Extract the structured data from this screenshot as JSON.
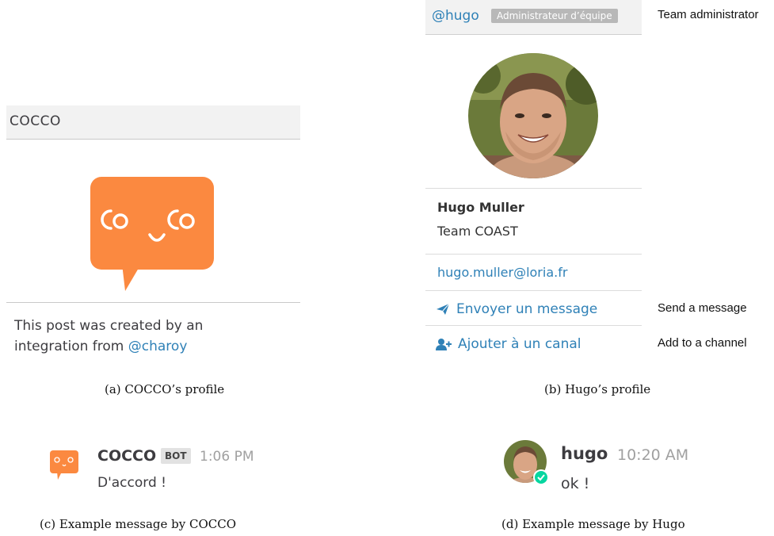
{
  "panel_a": {
    "header": "COCCO",
    "description": "This post was created by an integration from",
    "integration_user": "@charoy",
    "caption": "(a) COCCO’s profile"
  },
  "panel_b": {
    "username": "@hugo",
    "role_badge": "Administrateur d’équipe",
    "full_name": "Hugo Muller",
    "position": "Team COAST",
    "email": "hugo.muller@loria.fr",
    "send_message": "Envoyer un message",
    "add_to_channel": "Ajouter à un canal",
    "caption": "(b) Hugo’s profile",
    "annotations": {
      "role": "Team administrator",
      "send": "Send a message",
      "add": "Add to a channel"
    }
  },
  "message_c": {
    "author": "COCCO",
    "badge": "BOT",
    "time": "1:06 PM",
    "text": "D'accord !",
    "caption": "(c) Example message by COCCO"
  },
  "message_d": {
    "author": "hugo",
    "time": "10:20 AM",
    "text": "ok !",
    "caption": "(d) Example message by Hugo"
  },
  "colors": {
    "link": "#2f81b7",
    "cocco_orange": "#fb8940",
    "online_green": "#06d6a0",
    "header_bg": "#f2f2f2"
  },
  "icons": [
    "paper-plane-icon",
    "add-user-icon",
    "online-status-icon",
    "cocco-bot-avatar",
    "hugo-avatar"
  ]
}
